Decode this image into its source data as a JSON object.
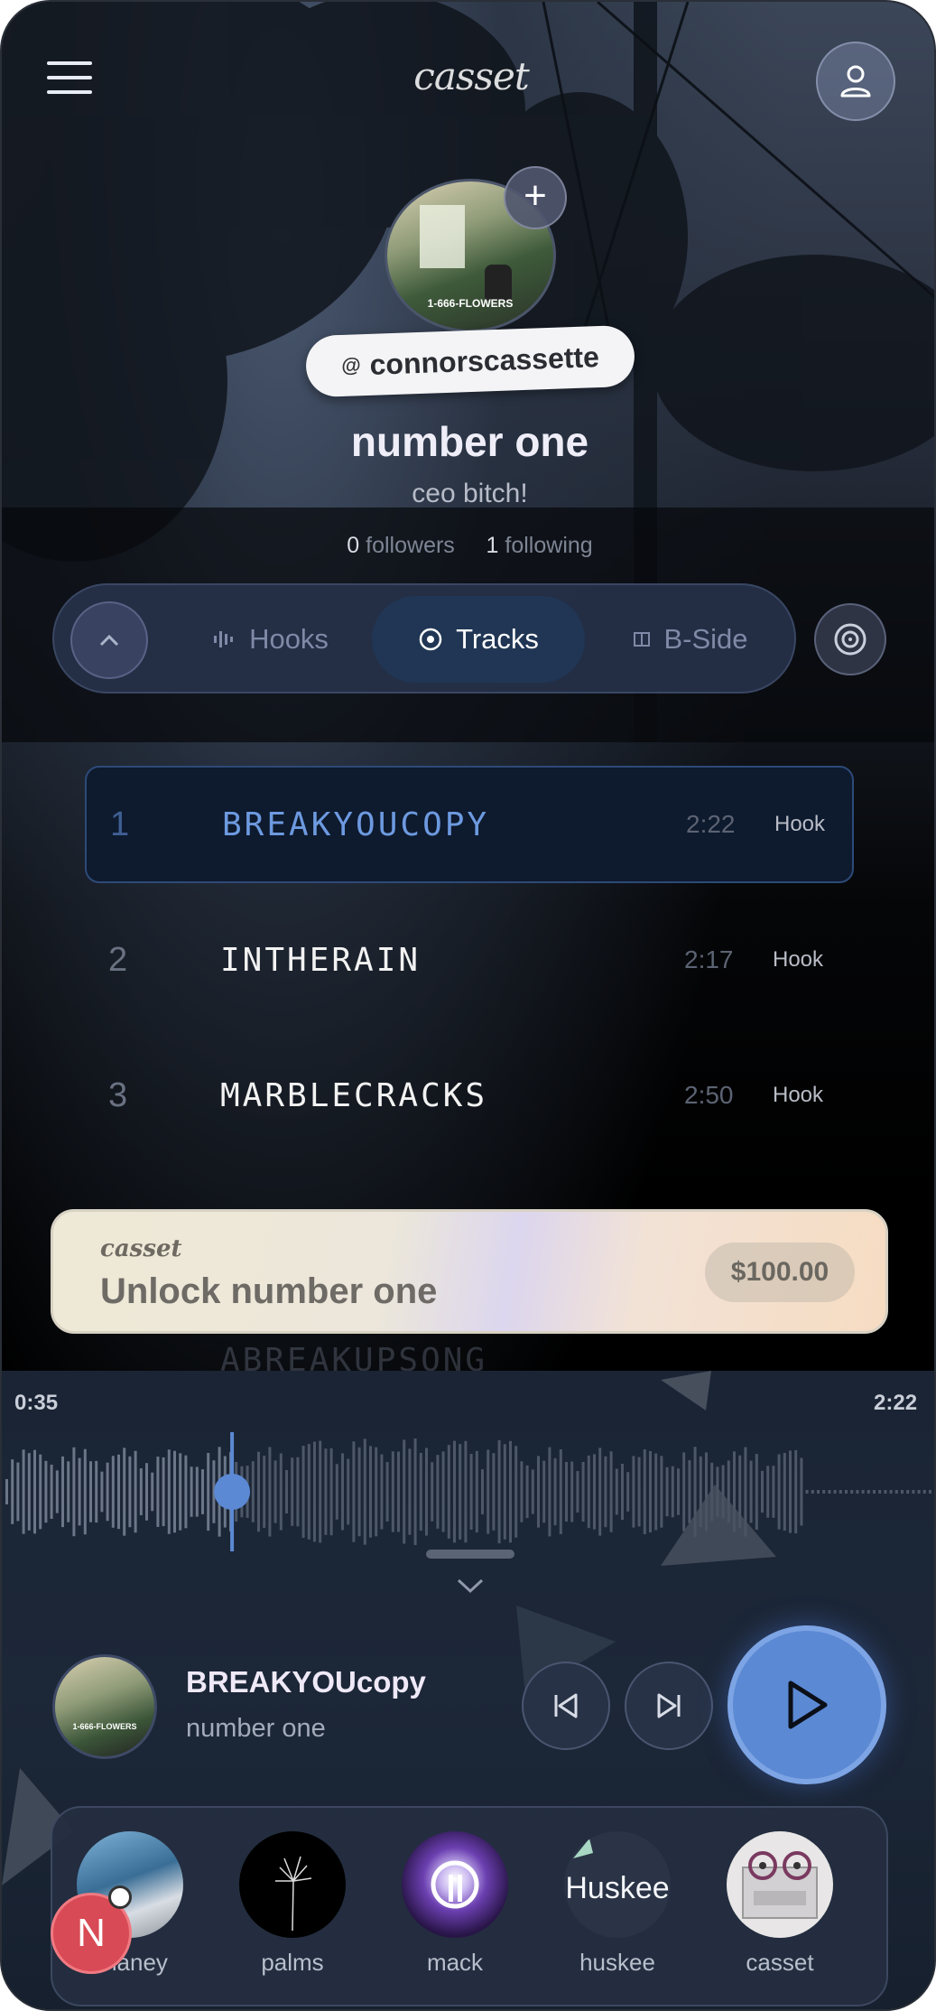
{
  "header": {
    "logo_text": "casset",
    "menu_icon": "hamburger-icon",
    "profile_icon": "user-icon"
  },
  "profile": {
    "avatar_caption": "1-666-FLOWERS",
    "follow_icon": "plus-icon",
    "handle_prefix": "@",
    "handle": "connorscassette",
    "name": "number one",
    "bio": "ceo bitch!",
    "followers_count": "0",
    "followers_label": "followers",
    "following_count": "1",
    "following_label": "following"
  },
  "tabs": {
    "collapse_icon": "chevron-up-icon",
    "items": [
      {
        "label": "Hooks",
        "icon": "waveform-icon",
        "selected": false
      },
      {
        "label": "Tracks",
        "icon": "target-icon",
        "selected": true
      },
      {
        "label": "B-Side",
        "icon": "split-square-icon",
        "selected": false
      }
    ],
    "disc_icon": "disc-icon"
  },
  "tracks": [
    {
      "num": "1",
      "title": "BREAKYOUCOPY",
      "duration": "2:22",
      "tag": "Hook",
      "active": true
    },
    {
      "num": "2",
      "title": "INTHERAIN",
      "duration": "2:17",
      "tag": "Hook",
      "active": false
    },
    {
      "num": "3",
      "title": "MARBLECRACKS",
      "duration": "2:50",
      "tag": "Hook",
      "active": false
    }
  ],
  "hidden_row_title": "ABREAKUPSONG",
  "unlock": {
    "brand": "casset",
    "label": "Unlock number one",
    "price": "$100.00"
  },
  "player": {
    "elapsed": "0:35",
    "total": "2:22",
    "progress": 0.246,
    "track_title": "BREAKYOUcopy",
    "artist": "number one",
    "art_caption": "1-666-FLOWERS"
  },
  "dock": {
    "notification_letter": "N",
    "items": [
      {
        "label": "zhaney"
      },
      {
        "label": "palms"
      },
      {
        "label": "mack"
      },
      {
        "label": "huskee",
        "logo_text": "Huskee"
      },
      {
        "label": "casset"
      }
    ]
  },
  "colors": {
    "accent": "#5b89d4",
    "active_track": "#6d9ae0",
    "notification": "#d84a55"
  }
}
